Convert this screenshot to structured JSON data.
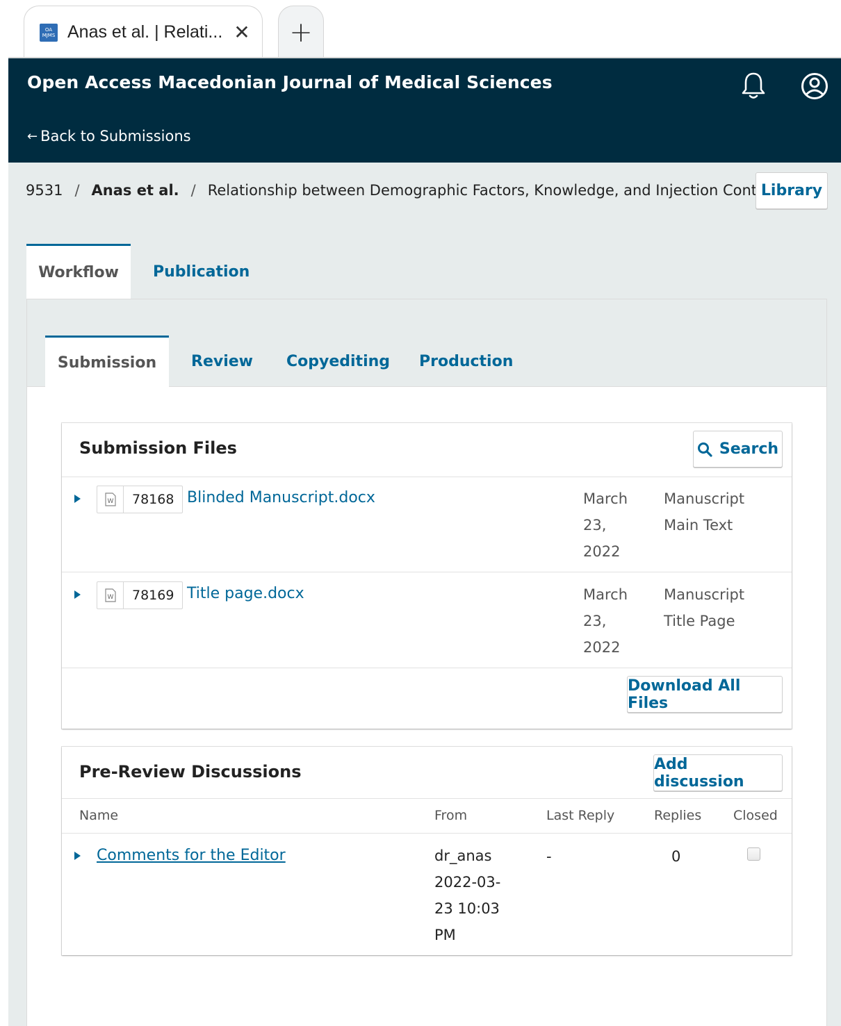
{
  "browser": {
    "tab_title": "Anas et al. | Relati...",
    "favicon_text_top": "OA",
    "favicon_text_bottom": "MJMS",
    "close_glyph": "✕",
    "new_tab_glyph": "+"
  },
  "header": {
    "journal_title": "Open Access Macedonian Journal of Medical Sciences",
    "back_label": "Back to Submissions",
    "back_arrow": "←"
  },
  "breadcrumb": {
    "id": "9531",
    "separator": "/",
    "author": "Anas et al.",
    "title": "Relationship between Demographic Factors, Knowledge, and Injection Cont"
  },
  "library_label": "Library",
  "main_tabs": [
    {
      "label": "Workflow",
      "active": true
    },
    {
      "label": "Publication",
      "active": false
    }
  ],
  "sub_tabs": [
    {
      "label": "Submission",
      "active": true
    },
    {
      "label": "Review",
      "active": false
    },
    {
      "label": "Copyediting",
      "active": false
    },
    {
      "label": "Production",
      "active": false
    }
  ],
  "submission_files": {
    "title": "Submission Files",
    "search_label": "Search",
    "download_all_label": "Download All Files",
    "files": [
      {
        "id": "78168",
        "name": "Blinded Manuscript.docx",
        "date_lines": [
          "March",
          "23,",
          "2022"
        ],
        "type_lines": [
          "Manuscript",
          "Main Text"
        ]
      },
      {
        "id": "78169",
        "name": "Title page.docx",
        "date_lines": [
          "March",
          "23,",
          "2022"
        ],
        "type_lines": [
          "Manuscript",
          "Title Page"
        ]
      }
    ]
  },
  "discussions": {
    "title": "Pre-Review Discussions",
    "add_label": "Add discussion",
    "columns": [
      "Name",
      "From",
      "Last Reply",
      "Replies",
      "Closed"
    ],
    "rows": [
      {
        "name": "Comments for the Editor",
        "from_lines": [
          "dr_anas",
          "2022-03-",
          "23 10:03",
          "PM"
        ],
        "last_reply": "-",
        "replies": "0",
        "closed": false
      }
    ]
  },
  "colors": {
    "header_bg": "#002c40",
    "link": "#006798",
    "page_bg": "#e7ecec"
  }
}
